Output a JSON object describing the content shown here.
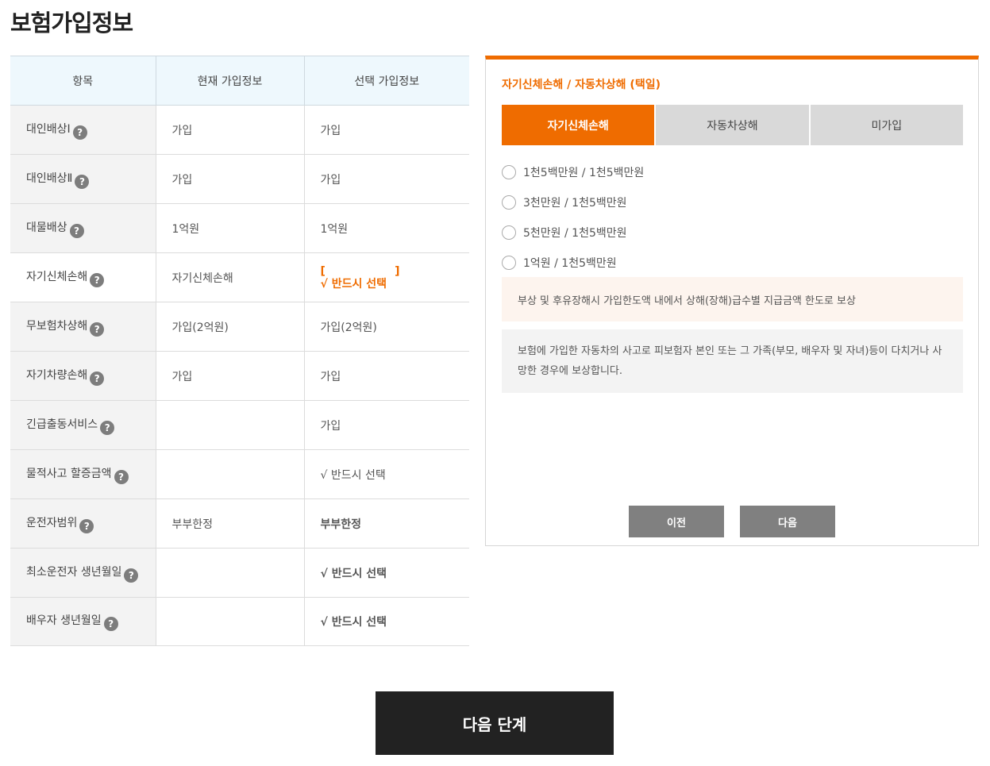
{
  "page_title": "보험가입정보",
  "table": {
    "headers": [
      "항목",
      "현재 가입정보",
      "선택 가입정보"
    ],
    "rows": [
      {
        "label": "대인배상Ⅰ",
        "current": "가입",
        "selected": "가입"
      },
      {
        "label": "대인배상Ⅱ",
        "current": "가입",
        "selected": "가입"
      },
      {
        "label": "대물배상",
        "current": "1억원",
        "selected": "1억원"
      },
      {
        "label": "자기신체손해",
        "current": "자기신체손해",
        "selected_bracket_open": "[",
        "selected_bracket_close": "]",
        "selected": "√ 반드시 선택"
      },
      {
        "label": "무보험차상해",
        "current": "가입(2억원)",
        "selected": "가입(2억원)"
      },
      {
        "label": "자기차량손해",
        "current": "가입",
        "selected": "가입"
      },
      {
        "label": "긴급출동서비스",
        "current": "",
        "selected": "가입"
      },
      {
        "label": "물적사고 할증금액",
        "current": "",
        "selected": "√ 반드시 선택"
      },
      {
        "label": "운전자범위",
        "current": "부부한정",
        "selected": "부부한정"
      },
      {
        "label": "최소운전자 생년월일",
        "current": "",
        "selected": "√ 반드시 선택"
      },
      {
        "label": "배우자 생년월일",
        "current": "",
        "selected": "√ 반드시 선택"
      }
    ],
    "help_icon_glyph": "?"
  },
  "panel": {
    "title": "자기신체손해 / 자동차상해 (택일)",
    "tabs": [
      "자기신체손해",
      "자동차상해",
      "미가입"
    ],
    "active_tab": "자기신체손해",
    "options": [
      "1천5백만원 / 1천5백만원",
      "3천만원 / 1천5백만원",
      "5천만원 / 1천5백만원",
      "1억원 / 1천5백만원"
    ],
    "note_orange": "부상 및 후유장해시 가입한도액 내에서 상해(장해)급수별 지급금액 한도로 보상",
    "note_grey": "보험에 가입한 자동차의 사고로 피보험자 본인 또는 그 가족(부모, 배우자 및 자녀)등이 다치거나 사망한 경우에 보상합니다.",
    "prev_label": "이전",
    "next_label": "다음"
  },
  "next_step_label": "다음 단계",
  "colors": {
    "accent": "#ef6c00",
    "header_bg": "#eef8fd",
    "label_bg": "#f3f3f3",
    "dark_button": "#222222",
    "grey_button": "#808080"
  }
}
